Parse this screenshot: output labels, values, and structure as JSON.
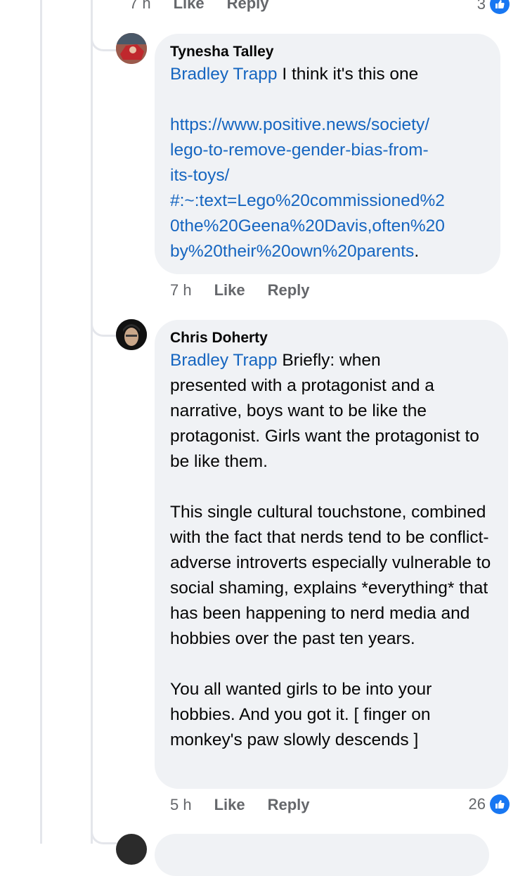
{
  "top_action_row": {
    "time": "7 h",
    "like": "Like",
    "reply": "Reply",
    "reaction_count": "3"
  },
  "comments": [
    {
      "author": "Tynesha Talley",
      "mention": "Bradley Trapp",
      "text_after_mention": " I think it's this one",
      "link_lines": [
        "https://www.positive.news/society/",
        "lego-to-remove-gender-bias-from-",
        "its-toys/",
        "#:~:text=Lego%20commissioned%2",
        "0the%20Geena%20Davis,often%20",
        "by%20their%20own%20parents"
      ],
      "link_suffix": ".",
      "time": "7 h",
      "like": "Like",
      "reply": "Reply"
    },
    {
      "author": "Chris Doherty",
      "mention": "Bradley Trapp",
      "para1_first": " Briefly: when",
      "para1_rest": "presented with a protagonist and a narrative, boys want to be like the protagonist.  Girls want the protagonist to be like them.",
      "para2": "This single cultural touchstone, combined with the fact that nerds tend to be conflict-adverse introverts especially vulnerable to social shaming, explains *everything* that has been happening to nerd media and hobbies over the past ten years.",
      "para3": "You all wanted girls to be into your hobbies.  And you got it. [ finger on monkey's paw slowly descends ]",
      "time": "5 h",
      "like": "Like",
      "reply": "Reply",
      "reaction_count": "26"
    }
  ],
  "icons": {
    "like_badge": "thumbs-up-icon",
    "like_badge_color": "#1877f2"
  }
}
